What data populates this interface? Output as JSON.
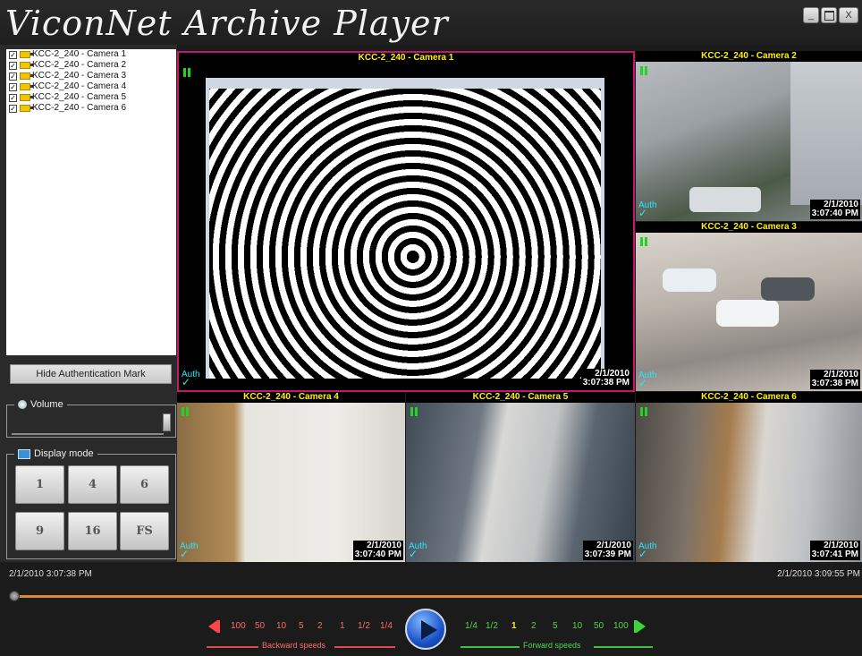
{
  "app": {
    "title": "ViconNet Archive Player"
  },
  "window_buttons": {
    "minimize": "_",
    "maximize": "",
    "close": "X"
  },
  "camera_list": [
    {
      "label": "KCC-2_240 - Camera 1",
      "checked": true
    },
    {
      "label": "KCC-2_240 - Camera 2",
      "checked": true
    },
    {
      "label": "KCC-2_240 - Camera 3",
      "checked": true
    },
    {
      "label": "KCC-2_240 - Camera 4",
      "checked": true
    },
    {
      "label": "KCC-2_240 - Camera 5",
      "checked": true
    },
    {
      "label": "KCC-2_240 - Camera 6",
      "checked": true
    }
  ],
  "hide_auth_label": "Hide Authentication Mark",
  "volume": {
    "label": "Volume",
    "level": 1.0
  },
  "display_mode": {
    "label": "Display mode",
    "buttons": [
      "1",
      "4",
      "6",
      "9",
      "16",
      "FS"
    ]
  },
  "videos": [
    {
      "title": "KCC-2_240 - Camera 1",
      "auth": "Auth",
      "date": "2/1/2010",
      "time": "3:07:38 PM"
    },
    {
      "title": "KCC-2_240 - Camera 2",
      "auth": "Auth",
      "date": "2/1/2010",
      "time": "3:07:40 PM"
    },
    {
      "title": "KCC-2_240 - Camera 3",
      "auth": "Auth",
      "date": "2/1/2010",
      "time": "3:07:38 PM"
    },
    {
      "title": "KCC-2_240 - Camera 4",
      "auth": "Auth",
      "date": "2/1/2010",
      "time": "3:07:40 PM"
    },
    {
      "title": "KCC-2_240 - Camera 5",
      "auth": "Auth",
      "date": "2/1/2010",
      "time": "3:07:39 PM"
    },
    {
      "title": "KCC-2_240 - Camera 6",
      "auth": "Auth",
      "date": "2/1/2010",
      "time": "3:07:41 PM"
    }
  ],
  "timeline": {
    "start": "2/1/2010 3:07:38 PM",
    "end": "2/1/2010 3:09:55 PM",
    "position": 0.0
  },
  "speeds": {
    "backward": [
      "100",
      "50",
      "10",
      "5",
      "2",
      "1",
      "1/2",
      "1/4"
    ],
    "forward_slow": [
      "1/4",
      "1/2"
    ],
    "current": "1",
    "forward": [
      "2",
      "5",
      "10",
      "50",
      "100"
    ],
    "backward_caption": "Backward speeds",
    "forward_caption": "Forward speeds"
  },
  "colors": {
    "selected_border": "#c2186b",
    "label_yellow": "#fff200",
    "auth_cyan": "#29e6ff",
    "seek_orange": "#d98a2c",
    "back_red": "#ff6a6a",
    "fwd_green": "#4dd84d"
  }
}
